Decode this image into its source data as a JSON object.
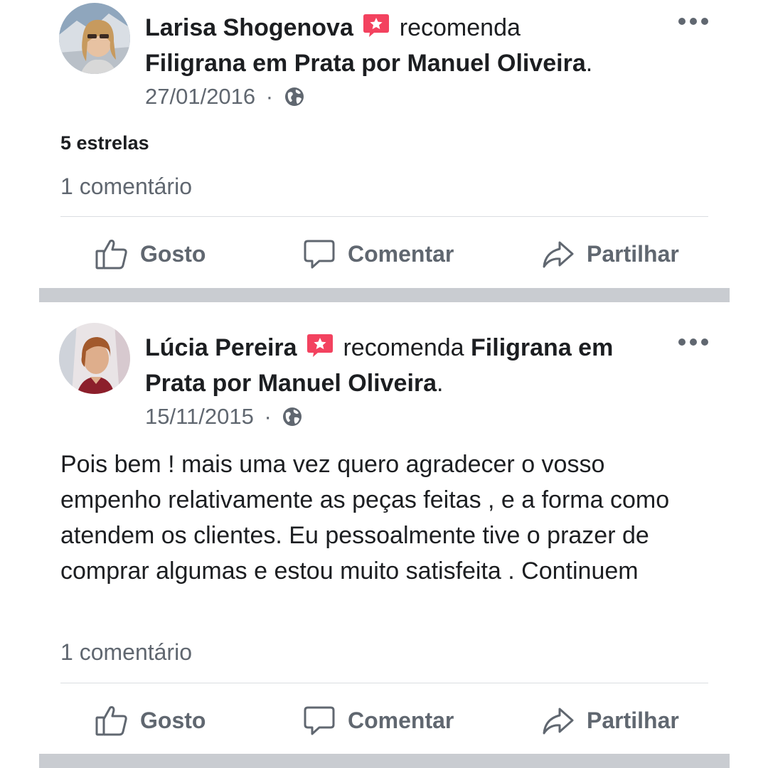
{
  "posts": [
    {
      "author": "Larisa Shogenova",
      "verb": "recomenda",
      "page": "Filigrana em Prata por Manuel Oliveira",
      "punct": ".",
      "date": "27/01/2016",
      "dot": "·",
      "privacy_icon": "globe-icon",
      "rating": "5 estrelas",
      "comments": "1 comentário",
      "actions": {
        "like": "Gosto",
        "comment": "Comentar",
        "share": "Partilhar"
      }
    },
    {
      "author": "Lúcia Pereira",
      "verb": "recomenda",
      "page": "Filigrana em Prata por Manuel Oliveira",
      "punct": ".",
      "date": "15/11/2015",
      "dot": "·",
      "privacy_icon": "globe-icon",
      "body": "Pois bem ! mais uma vez quero agradecer o vosso empenho relativamente as peças feitas , e a forma como atendem os clientes. Eu pessoalmente tive o prazer de comprar algumas e estou muito satisfeita . Continuem",
      "comments": "1 comentário",
      "actions": {
        "like": "Gosto",
        "comment": "Comentar",
        "share": "Partilhar"
      }
    }
  ],
  "colors": {
    "recommend_badge": "#f3425f",
    "secondary_text": "#606770",
    "divider": "#c9ccd1"
  }
}
